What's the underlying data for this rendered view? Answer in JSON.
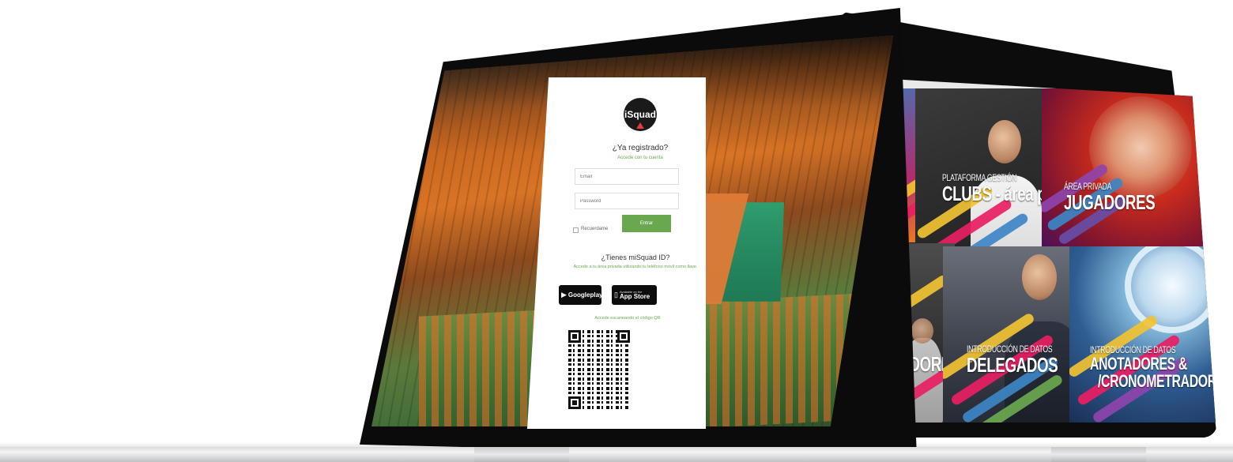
{
  "login": {
    "logo_text": "iSquad",
    "title": "¿Ya registrado?",
    "subtitle": "Accede con tu cuenta",
    "email_placeholder": "Email",
    "password_placeholder": "Password",
    "remember_label": "Recuerdame",
    "submit_label": "Entrar",
    "app_title": "¿Tienes miSquad ID?",
    "app_description": "Accede a tu área privada utilizando tu teléfono móvil como llave.",
    "google_play_label": "Googleplay",
    "app_store_small": "Available on the",
    "app_store_label": "App Store",
    "qr_label": "Accede escaneando el código QR"
  },
  "tiles": {
    "clubs": {
      "small": "PLATAFORMA GESTIÓN",
      "big": "CLUBS - área privada"
    },
    "jugadores": {
      "small": "ÁREA PRIVADA",
      "big": "JUGADORES"
    },
    "entrenadores": {
      "big": "ENADORES"
    },
    "delegados": {
      "small": "INTRODUCCIÓN DE DATOS",
      "big": "DELEGADOS"
    },
    "anotadores": {
      "small": "INTRODUCCIÓN DE DATOS",
      "big1": "ANOTADORES &",
      "big2": "/CRONOMETRADORES"
    }
  },
  "colors": {
    "accent_green": "#6aa84f",
    "bezel": "#0b0b0b"
  }
}
